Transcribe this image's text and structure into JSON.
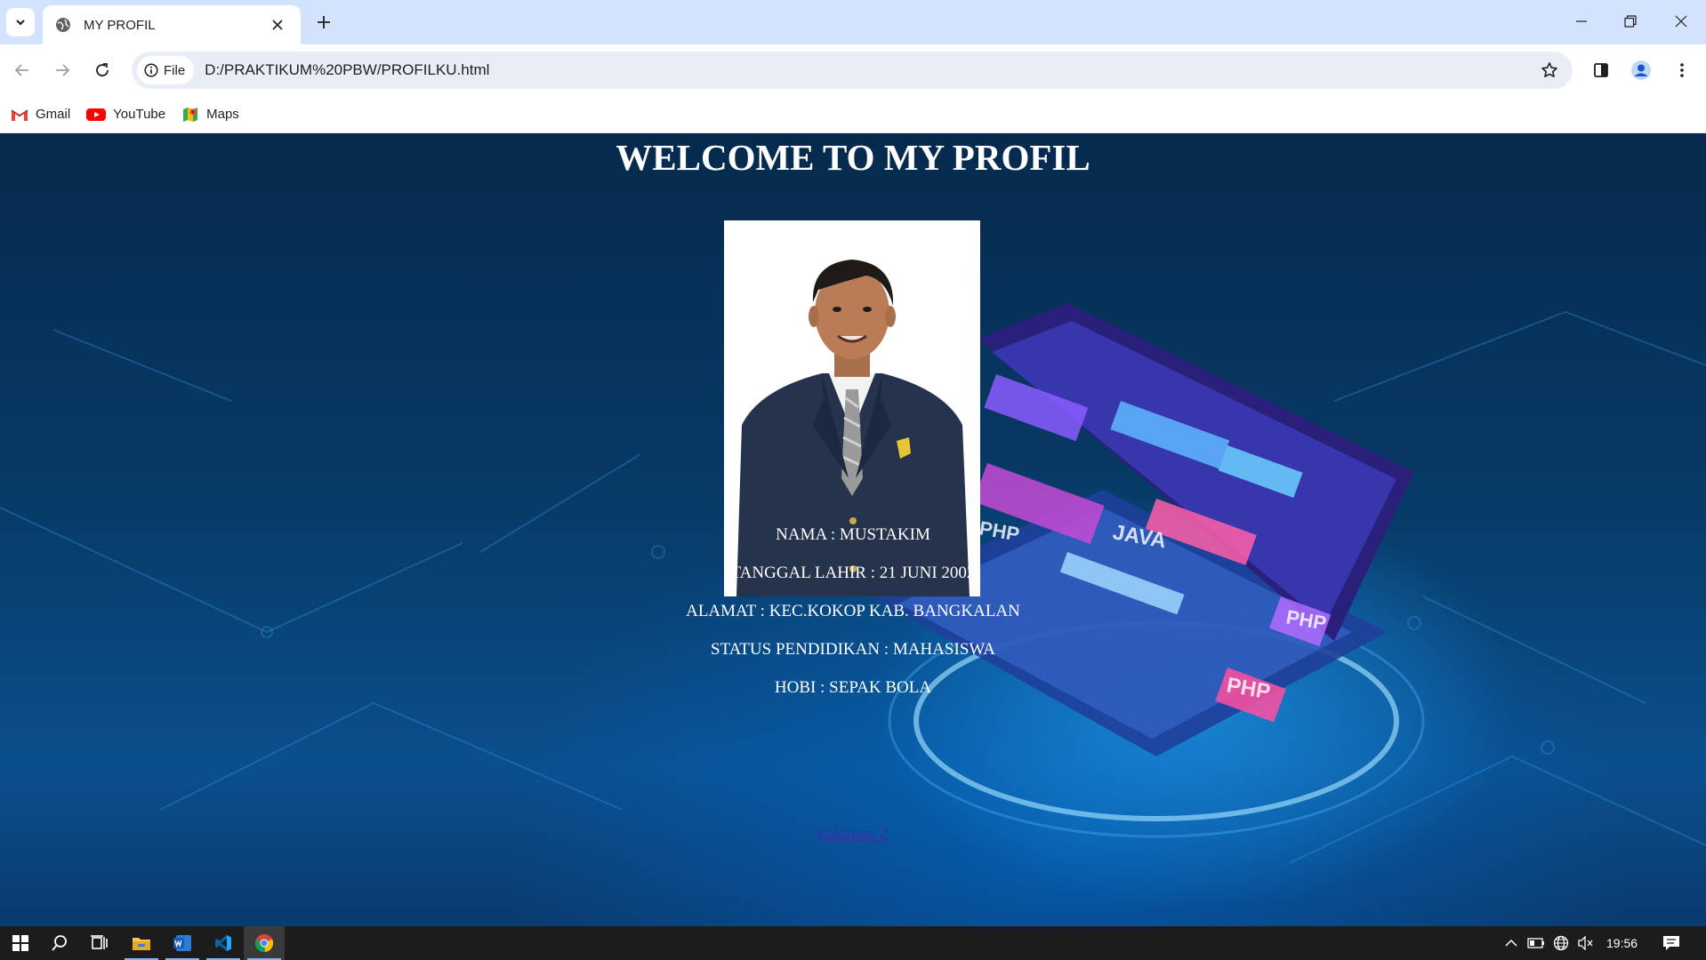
{
  "browser": {
    "tab": {
      "title": "MY PROFIL"
    },
    "omnibox": {
      "chip_label": "File",
      "url": "D:/PRAKTIKUM%20PBW/PROFILKU.html"
    },
    "bookmarks": [
      {
        "label": "Gmail",
        "icon": "gmail-icon"
      },
      {
        "label": "YouTube",
        "icon": "youtube-icon"
      },
      {
        "label": "Maps",
        "icon": "maps-icon"
      }
    ]
  },
  "page": {
    "title": "WELCOME TO MY PROFIL",
    "photo_alt": "profile-photo",
    "info": [
      "NAMA : MUSTAKIM",
      "TANGGAL LAHIR : 21 JUNI 2002",
      "ALAMAT : KEC.KOKOP KAB. BANGKALAN",
      "STATUS PENDIDIKAN : MAHASISWA",
      "HOBI : SEPAK BOLA"
    ],
    "next_link": "halaman 2",
    "background_tags": [
      "PHP",
      "JAVA",
      "PHP",
      "PHP"
    ]
  },
  "taskbar": {
    "apps": [
      "file-explorer-icon",
      "word-icon",
      "vscode-icon",
      "chrome-icon"
    ],
    "clock": "19:56"
  },
  "colors": {
    "tabstrip": "#d3e3fd",
    "page_bg": "#073a66",
    "link": "#3b2fa8",
    "taskbar": "#1c1c1c"
  }
}
